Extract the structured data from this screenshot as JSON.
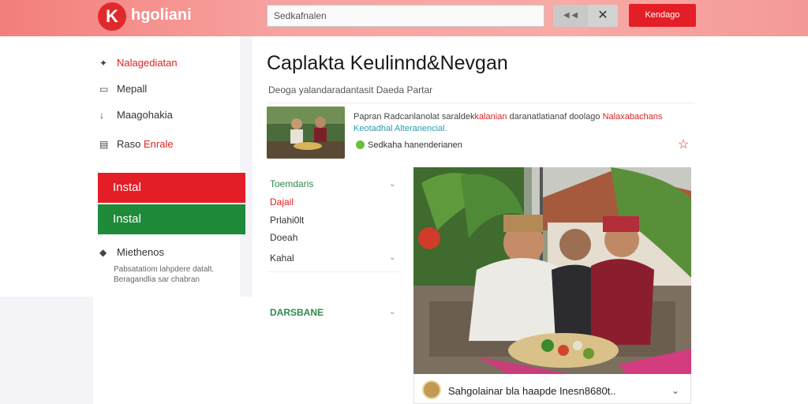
{
  "header": {
    "logo_glyph": "K",
    "logo_text": "hgoliani",
    "search_value": "Sedkafnalen",
    "btn_a_label": "◀ ◀",
    "close_label": "✕",
    "primary_button": "Kendago"
  },
  "sidebar": {
    "items": [
      {
        "icon": "compass-icon",
        "glyph": "✦",
        "label": "Nalagediatan",
        "red": true
      },
      {
        "icon": "monitor-icon",
        "glyph": "▭",
        "label": "Mepall",
        "red": false
      },
      {
        "icon": "arrow-down-icon",
        "glyph": "↓",
        "label": "Maagohakia",
        "red": false
      },
      {
        "icon": "document-icon",
        "glyph": "▤",
        "label_part1": "Raso",
        "label_part2": "Enrale",
        "red": false
      }
    ],
    "install_red": "Instal",
    "install_green": "Instal",
    "methods_label": "Miethenos",
    "note_line1": "Pabsatatiom lahpdere datalt.",
    "note_line2": "Beragandlia sar chabran"
  },
  "main": {
    "title": "Caplakta Keulinnd&Nevgan",
    "subtitle": "Deoga yalandaradantasit Daeda Partar",
    "desc_line1_a": "Papran Radcanlanolat saraldek",
    "desc_line1_red1": "kalanian",
    "desc_line1_b": "daranatlatianaf doolago",
    "desc_line1_red2": "Nalaxabachans",
    "desc_line2": "Keotadhal Alteranencial.",
    "meta": "Sedkaha hanenderianen"
  },
  "filters": [
    {
      "label": "Toemdaris",
      "color": "green"
    },
    {
      "label": "Dajail",
      "color": "red"
    },
    {
      "label": "Prlahi0lt",
      "color": "dark"
    },
    {
      "label": "Doeah",
      "color": "dark"
    },
    {
      "label": "Kahal",
      "color": "dark"
    }
  ],
  "filter_strong": "DARSBANE",
  "caption": "Sahgolainar bla haapde Inesn8680t..",
  "colors": {
    "brand_red": "#e41e26",
    "brand_green": "#1e8a3a",
    "accent_green": "#2f8a4a"
  }
}
